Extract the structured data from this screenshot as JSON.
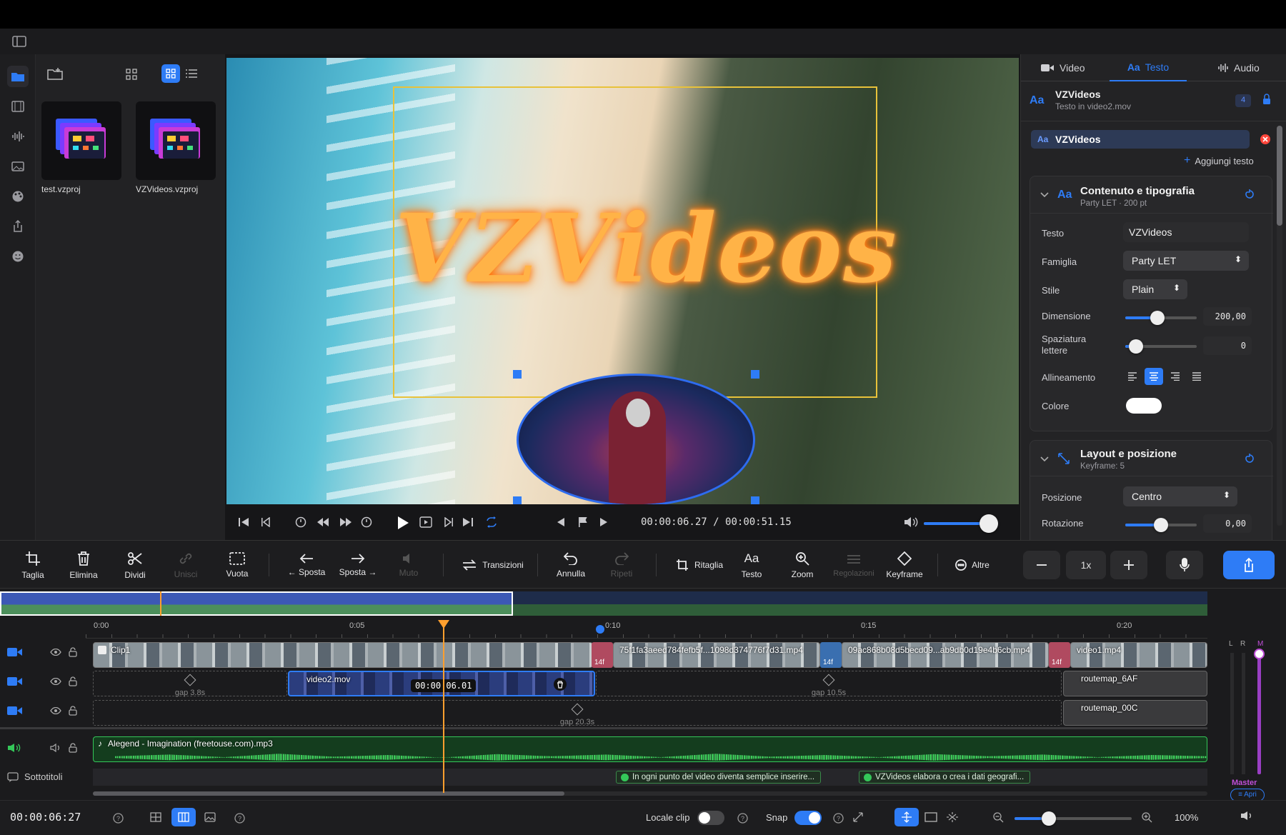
{
  "browser": {
    "files": [
      {
        "name": "test.vzproj"
      },
      {
        "name": "VZVideos.vzproj"
      }
    ]
  },
  "viewer": {
    "overlay_text": "VZVideos",
    "timecode_current": "00:00:06.27",
    "timecode_separator": "/",
    "timecode_total": "00:00:51.15",
    "volume_level": 0.85
  },
  "inspector": {
    "tabs": [
      {
        "label": "Video"
      },
      {
        "label": "Testo"
      },
      {
        "label": "Audio"
      }
    ],
    "active_tab": "Testo",
    "item": {
      "title": "VZVideos",
      "subtitle": "Testo in video2.mov",
      "badge": "4"
    },
    "text_chip": "VZVideos",
    "add_text": "Aggiungi testo",
    "sections": {
      "typography": {
        "title": "Contenuto e tipografia",
        "subtitle": "Party LET · 200 pt",
        "rows": {
          "testo_label": "Testo",
          "testo_value": "VZVideos",
          "famiglia_label": "Famiglia",
          "famiglia_value": "Party LET",
          "stile_label": "Stile",
          "stile_value": "Plain",
          "dimensione_label": "Dimensione",
          "dimensione_value": "200,00",
          "dimensione_level": 0.45,
          "spaziatura_label": "Spaziatura lettere",
          "spaziatura_value": "0",
          "spaziatura_level": 0.15,
          "allineamento_label": "Allineamento",
          "colore_label": "Colore",
          "colore_hex": "#ffffff"
        }
      },
      "layout": {
        "title": "Layout e posizione",
        "subtitle": "Keyframe: 5",
        "rows": {
          "posizione_label": "Posizione",
          "posizione_value": "Centro",
          "rotazione_label": "Rotazione",
          "rotazione_value": "0,00",
          "rotazione_level": 0.5
        }
      }
    }
  },
  "toolbar": {
    "items": {
      "taglia": "Taglia",
      "elimina": "Elimina",
      "dividi": "Dividi",
      "unisci": "Unisci",
      "vuota": "Vuota",
      "sposta_left": "← Sposta",
      "sposta_right": "Sposta →",
      "muto": "Muto",
      "transizioni": "Transizioni",
      "annulla": "Annulla",
      "ripeti": "Ripeti",
      "ritaglia": "Ritaglia",
      "testo": "Testo",
      "zoom": "Zoom",
      "regolazioni": "Regolazioni",
      "keyframe": "Keyframe",
      "altre": "Altre"
    },
    "speed": "1x"
  },
  "timeline": {
    "ruler": [
      "0:00",
      "0:05",
      "0:10",
      "0:15",
      "0:20"
    ],
    "playhead_time": "00:00:06.01",
    "track1": {
      "clips": [
        {
          "name": "Clip1"
        },
        {
          "name": "75f1fa3aeed784fefb5f...1098d374776f7d31.mp4"
        },
        {
          "name": "09ac868b08d5becd09...ab9db0d19e4b6cb.mp4"
        },
        {
          "name": "video1.mp4"
        }
      ],
      "transition_label": "14f"
    },
    "track2": {
      "gap1": "gap 3.8s",
      "clip": "video2.mov",
      "gap2": "gap 10.5s",
      "clip2": "routemap_6AF"
    },
    "track3": {
      "gap": "gap 20.3s",
      "clip": "routemap_00C"
    },
    "audio": {
      "name": "Alegend - Imagination (freetouse.com).mp3"
    },
    "subtitles": {
      "label": "Sottotitoli",
      "items": [
        "In ogni punto del video diventa semplice inserire...",
        "VZVideos elabora o crea i dati geografi..."
      ]
    },
    "meter": {
      "l": "L",
      "r": "R",
      "m": "M",
      "master": "Master",
      "apri": "Apri"
    }
  },
  "status": {
    "timecode": "00:00:06:27",
    "locale_clip": "Locale clip",
    "snap": "Snap",
    "zoom_pct": "100%"
  },
  "colors": {
    "accent": "#2e7cf6",
    "playhead": "#ff9f2e",
    "video_track": "#2f65d6",
    "audio_wave": "#3ccf5a",
    "text_box": "#e8c23a"
  }
}
